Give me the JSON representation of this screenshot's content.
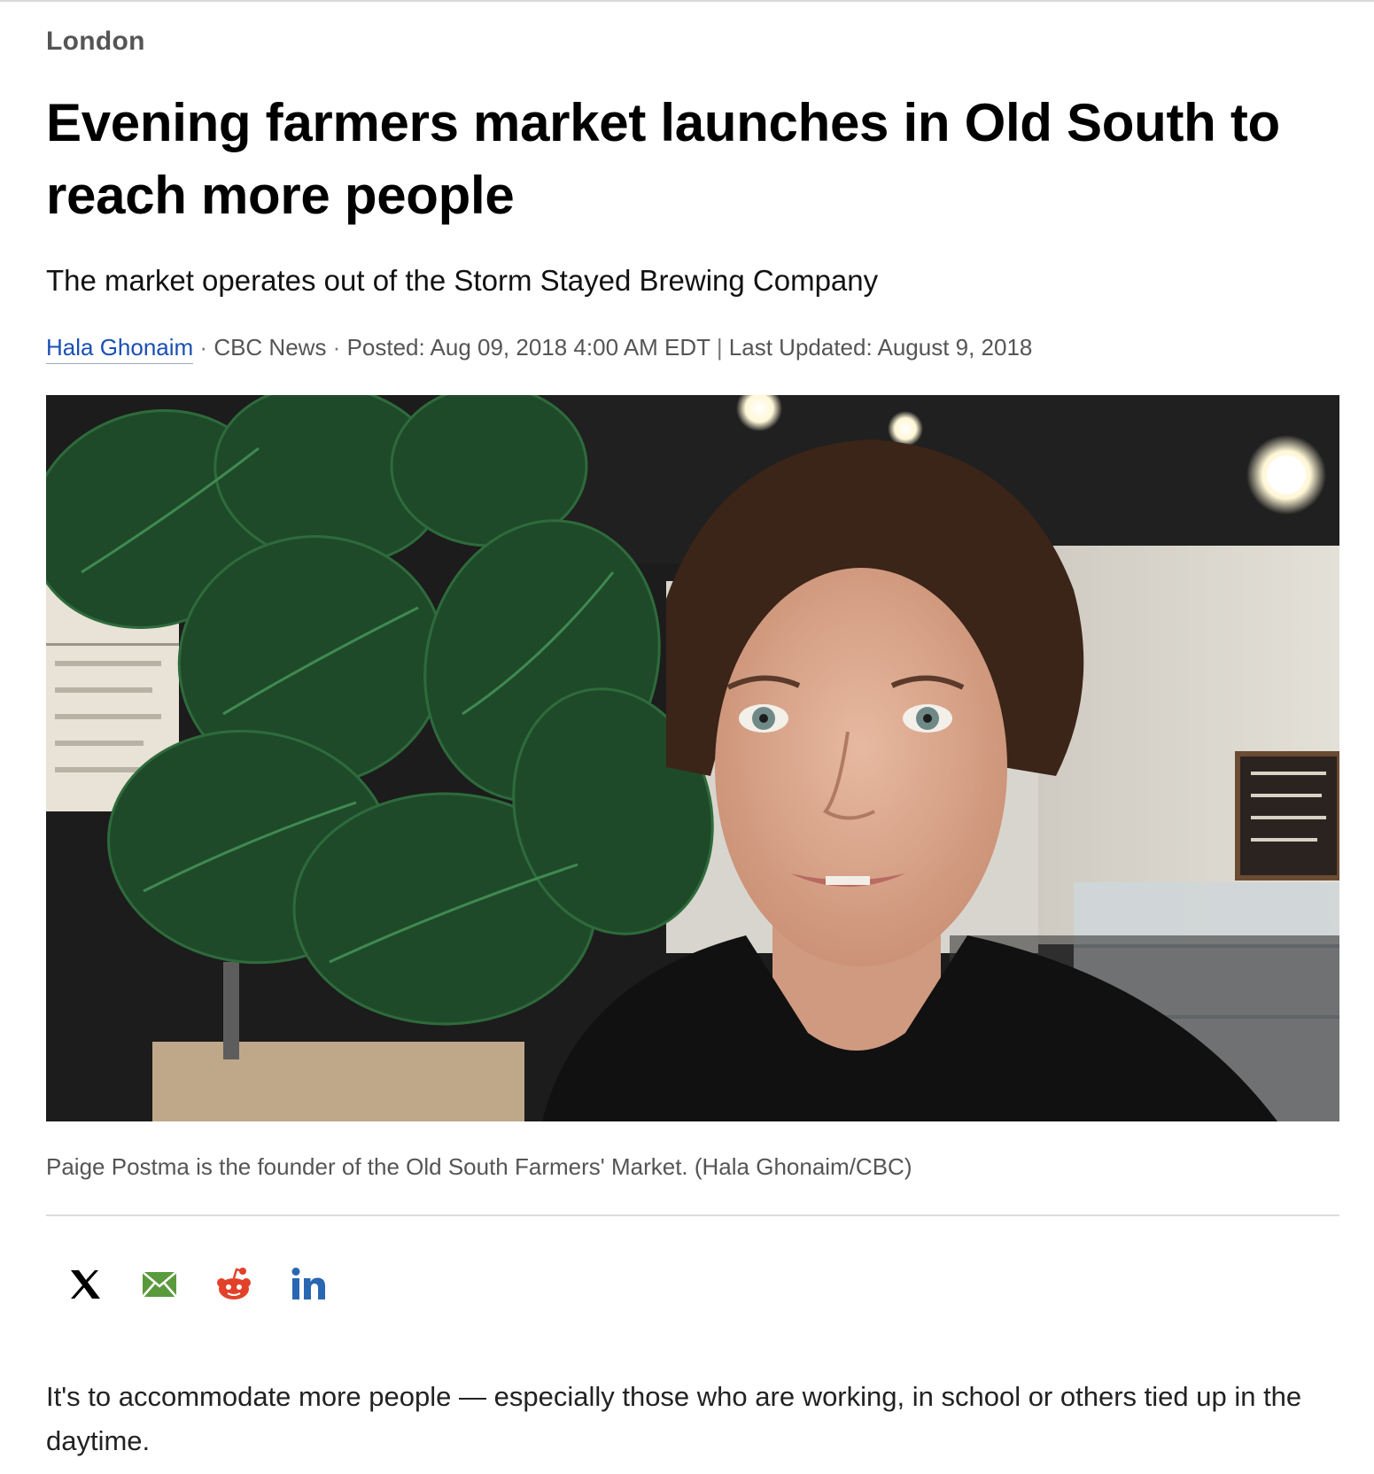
{
  "section": "London",
  "headline": "Evening farmers market launches in Old South to reach more people",
  "deck": "The market operates out of the Storm Stayed Brewing Company",
  "byline": {
    "author": "Hala Ghonaim",
    "sep1": " · ",
    "outlet": "CBC News",
    "sep2": " · ",
    "posted": "Posted: Aug 09, 2018 4:00 AM EDT",
    "sep3": " | ",
    "updated": "Last Updated: August 9, 2018"
  },
  "photo": {
    "alt": "Paige Postma is the founder of the Old South Farmers' Market."
  },
  "caption": "Paige Postma is the founder of the Old South Farmers' Market. (Hala Ghonaim/CBC)",
  "share": {
    "icons": [
      "x-icon",
      "email-icon",
      "reddit-icon",
      "linkedin-icon"
    ],
    "colors": {
      "x": "#000000",
      "email": "#5b9a3c",
      "reddit": "#e2412a",
      "linkedin": "#2a67b2"
    }
  },
  "body": {
    "paragraph_1": "It's to accommodate more people — especially those who are working, in school or others tied up in the daytime."
  }
}
